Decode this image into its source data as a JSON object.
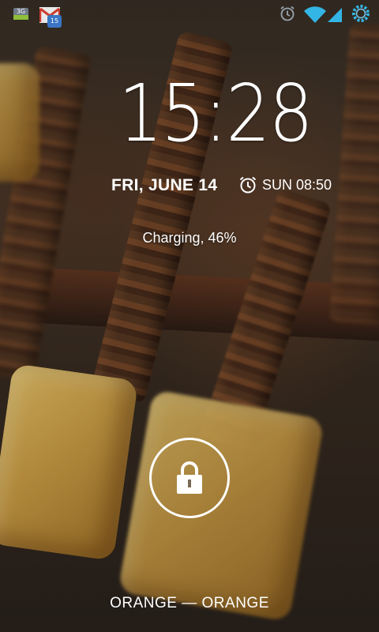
{
  "status_bar": {
    "notifications": [
      {
        "icon": "data-3g-notification-icon",
        "label": "3G"
      },
      {
        "icon": "gmail-icon",
        "badge": "15"
      }
    ],
    "system_icons": [
      "alarm-icon",
      "wifi-icon",
      "signal-icon",
      "battery-charging-icon"
    ],
    "accent_color": "#33b5e5"
  },
  "lockscreen": {
    "time": "15:28",
    "date": "FRI, JUNE 14",
    "alarm": {
      "icon": "alarm-icon",
      "text": "SUN 08:50"
    },
    "charging": "Charging, 46%",
    "unlock_icon": "padlock-icon",
    "carrier": "ORANGE — ORANGE"
  }
}
